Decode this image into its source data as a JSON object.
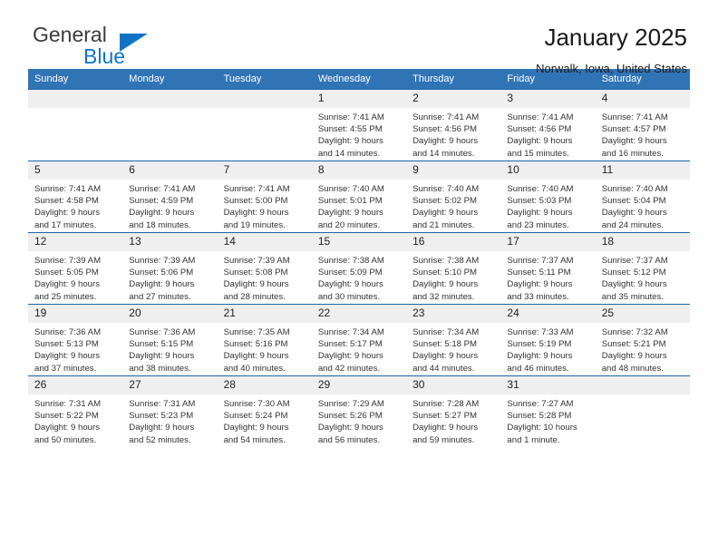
{
  "brand": {
    "name_part1": "General",
    "name_part2": "Blue",
    "logo_icon": "blue-triangle-icon",
    "colors": {
      "text": "#3b3b3b",
      "accent": "#1273c4"
    }
  },
  "header": {
    "title": "January 2025",
    "subtitle": "Norwalk, Iowa, United States"
  },
  "calendar": {
    "accent_color": "#3174b5",
    "daynum_band_color": "#efefef",
    "weekdays": [
      "Sunday",
      "Monday",
      "Tuesday",
      "Wednesday",
      "Thursday",
      "Friday",
      "Saturday"
    ],
    "labels": {
      "sunrise_prefix": "Sunrise:",
      "sunset_prefix": "Sunset:",
      "daylight_prefix": "Daylight:"
    },
    "weeks": [
      [
        {
          "day": "",
          "empty": true,
          "line1": "",
          "line2": "",
          "line3": "",
          "line4": ""
        },
        {
          "day": "",
          "empty": true,
          "line1": "",
          "line2": "",
          "line3": "",
          "line4": ""
        },
        {
          "day": "",
          "empty": true,
          "line1": "",
          "line2": "",
          "line3": "",
          "line4": ""
        },
        {
          "day": "1",
          "line1": "Sunrise: 7:41 AM",
          "line2": "Sunset: 4:55 PM",
          "line3": "Daylight: 9 hours",
          "line4": "and 14 minutes."
        },
        {
          "day": "2",
          "line1": "Sunrise: 7:41 AM",
          "line2": "Sunset: 4:56 PM",
          "line3": "Daylight: 9 hours",
          "line4": "and 14 minutes."
        },
        {
          "day": "3",
          "line1": "Sunrise: 7:41 AM",
          "line2": "Sunset: 4:56 PM",
          "line3": "Daylight: 9 hours",
          "line4": "and 15 minutes."
        },
        {
          "day": "4",
          "line1": "Sunrise: 7:41 AM",
          "line2": "Sunset: 4:57 PM",
          "line3": "Daylight: 9 hours",
          "line4": "and 16 minutes."
        }
      ],
      [
        {
          "day": "5",
          "line1": "Sunrise: 7:41 AM",
          "line2": "Sunset: 4:58 PM",
          "line3": "Daylight: 9 hours",
          "line4": "and 17 minutes."
        },
        {
          "day": "6",
          "line1": "Sunrise: 7:41 AM",
          "line2": "Sunset: 4:59 PM",
          "line3": "Daylight: 9 hours",
          "line4": "and 18 minutes."
        },
        {
          "day": "7",
          "line1": "Sunrise: 7:41 AM",
          "line2": "Sunset: 5:00 PM",
          "line3": "Daylight: 9 hours",
          "line4": "and 19 minutes."
        },
        {
          "day": "8",
          "line1": "Sunrise: 7:40 AM",
          "line2": "Sunset: 5:01 PM",
          "line3": "Daylight: 9 hours",
          "line4": "and 20 minutes."
        },
        {
          "day": "9",
          "line1": "Sunrise: 7:40 AM",
          "line2": "Sunset: 5:02 PM",
          "line3": "Daylight: 9 hours",
          "line4": "and 21 minutes."
        },
        {
          "day": "10",
          "line1": "Sunrise: 7:40 AM",
          "line2": "Sunset: 5:03 PM",
          "line3": "Daylight: 9 hours",
          "line4": "and 23 minutes."
        },
        {
          "day": "11",
          "line1": "Sunrise: 7:40 AM",
          "line2": "Sunset: 5:04 PM",
          "line3": "Daylight: 9 hours",
          "line4": "and 24 minutes."
        }
      ],
      [
        {
          "day": "12",
          "line1": "Sunrise: 7:39 AM",
          "line2": "Sunset: 5:05 PM",
          "line3": "Daylight: 9 hours",
          "line4": "and 25 minutes."
        },
        {
          "day": "13",
          "line1": "Sunrise: 7:39 AM",
          "line2": "Sunset: 5:06 PM",
          "line3": "Daylight: 9 hours",
          "line4": "and 27 minutes."
        },
        {
          "day": "14",
          "line1": "Sunrise: 7:39 AM",
          "line2": "Sunset: 5:08 PM",
          "line3": "Daylight: 9 hours",
          "line4": "and 28 minutes."
        },
        {
          "day": "15",
          "line1": "Sunrise: 7:38 AM",
          "line2": "Sunset: 5:09 PM",
          "line3": "Daylight: 9 hours",
          "line4": "and 30 minutes."
        },
        {
          "day": "16",
          "line1": "Sunrise: 7:38 AM",
          "line2": "Sunset: 5:10 PM",
          "line3": "Daylight: 9 hours",
          "line4": "and 32 minutes."
        },
        {
          "day": "17",
          "line1": "Sunrise: 7:37 AM",
          "line2": "Sunset: 5:11 PM",
          "line3": "Daylight: 9 hours",
          "line4": "and 33 minutes."
        },
        {
          "day": "18",
          "line1": "Sunrise: 7:37 AM",
          "line2": "Sunset: 5:12 PM",
          "line3": "Daylight: 9 hours",
          "line4": "and 35 minutes."
        }
      ],
      [
        {
          "day": "19",
          "line1": "Sunrise: 7:36 AM",
          "line2": "Sunset: 5:13 PM",
          "line3": "Daylight: 9 hours",
          "line4": "and 37 minutes."
        },
        {
          "day": "20",
          "line1": "Sunrise: 7:36 AM",
          "line2": "Sunset: 5:15 PM",
          "line3": "Daylight: 9 hours",
          "line4": "and 38 minutes."
        },
        {
          "day": "21",
          "line1": "Sunrise: 7:35 AM",
          "line2": "Sunset: 5:16 PM",
          "line3": "Daylight: 9 hours",
          "line4": "and 40 minutes."
        },
        {
          "day": "22",
          "line1": "Sunrise: 7:34 AM",
          "line2": "Sunset: 5:17 PM",
          "line3": "Daylight: 9 hours",
          "line4": "and 42 minutes."
        },
        {
          "day": "23",
          "line1": "Sunrise: 7:34 AM",
          "line2": "Sunset: 5:18 PM",
          "line3": "Daylight: 9 hours",
          "line4": "and 44 minutes."
        },
        {
          "day": "24",
          "line1": "Sunrise: 7:33 AM",
          "line2": "Sunset: 5:19 PM",
          "line3": "Daylight: 9 hours",
          "line4": "and 46 minutes."
        },
        {
          "day": "25",
          "line1": "Sunrise: 7:32 AM",
          "line2": "Sunset: 5:21 PM",
          "line3": "Daylight: 9 hours",
          "line4": "and 48 minutes."
        }
      ],
      [
        {
          "day": "26",
          "line1": "Sunrise: 7:31 AM",
          "line2": "Sunset: 5:22 PM",
          "line3": "Daylight: 9 hours",
          "line4": "and 50 minutes."
        },
        {
          "day": "27",
          "line1": "Sunrise: 7:31 AM",
          "line2": "Sunset: 5:23 PM",
          "line3": "Daylight: 9 hours",
          "line4": "and 52 minutes."
        },
        {
          "day": "28",
          "line1": "Sunrise: 7:30 AM",
          "line2": "Sunset: 5:24 PM",
          "line3": "Daylight: 9 hours",
          "line4": "and 54 minutes."
        },
        {
          "day": "29",
          "line1": "Sunrise: 7:29 AM",
          "line2": "Sunset: 5:26 PM",
          "line3": "Daylight: 9 hours",
          "line4": "and 56 minutes."
        },
        {
          "day": "30",
          "line1": "Sunrise: 7:28 AM",
          "line2": "Sunset: 5:27 PM",
          "line3": "Daylight: 9 hours",
          "line4": "and 59 minutes."
        },
        {
          "day": "31",
          "line1": "Sunrise: 7:27 AM",
          "line2": "Sunset: 5:28 PM",
          "line3": "Daylight: 10 hours",
          "line4": "and 1 minute."
        },
        {
          "day": "",
          "empty": true,
          "line1": "",
          "line2": "",
          "line3": "",
          "line4": ""
        }
      ]
    ]
  }
}
